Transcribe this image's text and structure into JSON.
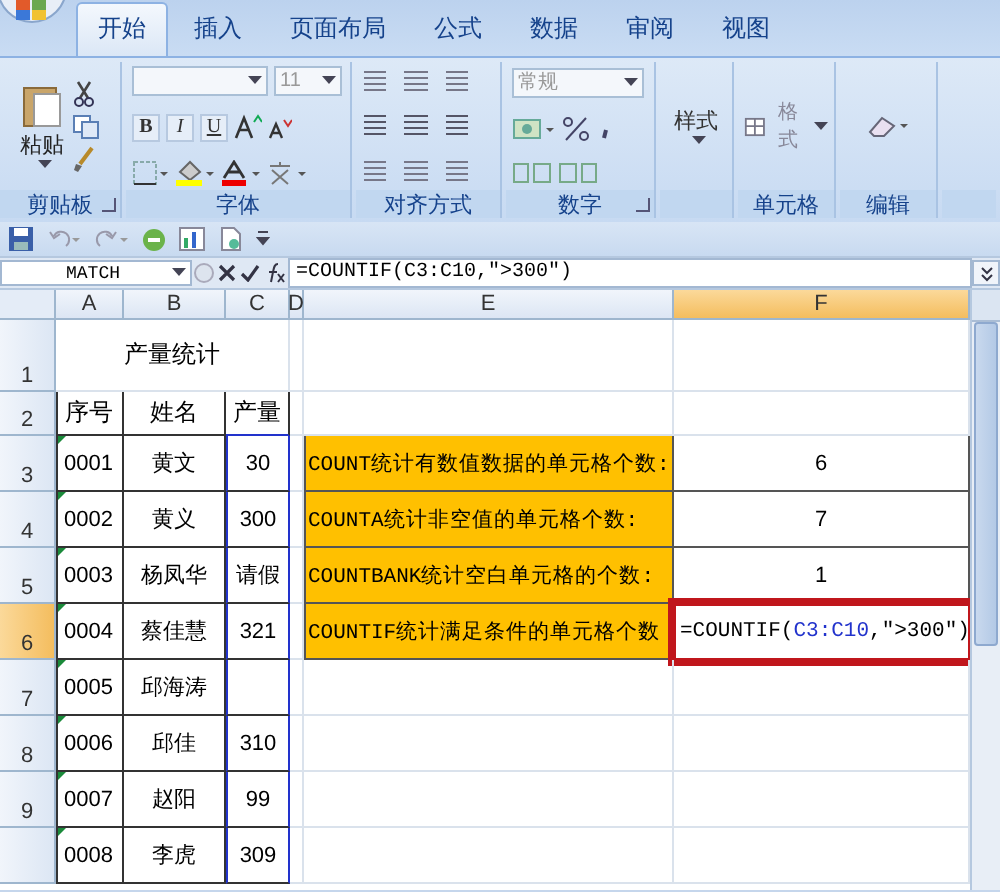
{
  "ribbon": {
    "tabs": [
      {
        "label": "开始",
        "selected": true
      },
      {
        "label": "插入",
        "selected": false
      },
      {
        "label": "页面布局",
        "selected": false
      },
      {
        "label": "公式",
        "selected": false
      },
      {
        "label": "数据",
        "selected": false
      },
      {
        "label": "审阅",
        "selected": false
      },
      {
        "label": "视图",
        "selected": false
      }
    ],
    "paste_label": "粘贴",
    "font_size": "11",
    "font_buttons": [
      "B",
      "I",
      "U"
    ],
    "number_format": "常规",
    "styles_label": "样式",
    "format_label": "格式",
    "groups": [
      "剪贴板",
      "字体",
      "对齐方式",
      "数字",
      "单元格",
      "编辑"
    ]
  },
  "formula_bar": {
    "name_box": "MATCH",
    "formula": "=COUNTIF(C3:C10,\">300\")"
  },
  "sheet": {
    "columns": [
      {
        "label": "A",
        "selected": false
      },
      {
        "label": "B",
        "selected": false
      },
      {
        "label": "C",
        "selected": false
      },
      {
        "label": "D",
        "selected": false
      },
      {
        "label": "E",
        "selected": false
      },
      {
        "label": "F",
        "selected": true
      }
    ],
    "rows": [
      {
        "label": "1",
        "selected": false
      },
      {
        "label": "2",
        "selected": false
      },
      {
        "label": "3",
        "selected": false
      },
      {
        "label": "4",
        "selected": false
      },
      {
        "label": "5",
        "selected": false
      },
      {
        "label": "6",
        "selected": true
      },
      {
        "label": "7",
        "selected": false
      },
      {
        "label": "8",
        "selected": false
      },
      {
        "label": "9",
        "selected": false
      }
    ],
    "title": "产量统计",
    "headers": [
      "序号",
      "姓名",
      "产量"
    ],
    "records": [
      {
        "id": "0001",
        "name": "黄文",
        "output": "30",
        "text_warning": true
      },
      {
        "id": "0002",
        "name": "黄义",
        "output": "300",
        "text_warning": true
      },
      {
        "id": "0003",
        "name": "杨凤华",
        "output": "请假",
        "text_warning": true
      },
      {
        "id": "0004",
        "name": "蔡佳慧",
        "output": "321",
        "text_warning": true
      },
      {
        "id": "0005",
        "name": "邱海涛",
        "text_warning": true
      },
      {
        "id": "0006",
        "name": "邱佳",
        "output": "310",
        "text_warning": true
      },
      {
        "id": "0007",
        "name": "赵阳",
        "output": "99",
        "text_warning": true
      },
      {
        "id": "0008",
        "name": "李虎",
        "output": "309",
        "text_warning": true
      }
    ],
    "stats": [
      {
        "kind": "value",
        "label": "COUNT统计有数值数据的单元格个数:",
        "value": "6"
      },
      {
        "kind": "value",
        "label": "COUNTA统计非空值的单元格个数:",
        "value": "7"
      },
      {
        "kind": "value",
        "label": "COUNTBANK统计空白单元格的个数:",
        "value": "1"
      },
      {
        "kind": "editing",
        "label": "COUNTIF统计满足条件的单元格个数",
        "edit": {
          "before": "=COUNTIF(",
          "reference": "C3:C10",
          "after": ",\">300\")"
        }
      }
    ]
  }
}
